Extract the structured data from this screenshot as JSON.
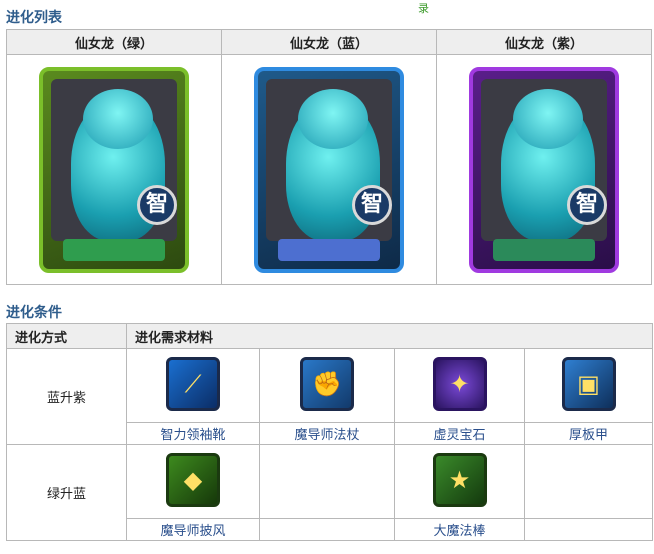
{
  "top_mark": "录",
  "evolution_list": {
    "title": "进化列表",
    "columns": [
      "仙女龙（绿）",
      "仙女龙（蓝）",
      "仙女龙（紫）"
    ],
    "cards": [
      {
        "variant": "green",
        "badge": "智",
        "frame_color": "#7bbf2a"
      },
      {
        "variant": "blue",
        "badge": "智",
        "frame_color": "#2f8be0"
      },
      {
        "variant": "purple",
        "badge": "智",
        "frame_color": "#a03ae0"
      }
    ]
  },
  "evolution_conditions": {
    "title": "进化条件",
    "headers": {
      "method": "进化方式",
      "materials": "进化需求材料"
    },
    "rows": [
      {
        "method": "蓝升紫",
        "materials": [
          {
            "name": "智力领袖靴",
            "icon": "boot-icon"
          },
          {
            "name": "魔导师法杖",
            "icon": "staff-icon"
          },
          {
            "name": "虚灵宝石",
            "icon": "gem-icon"
          },
          {
            "name": "厚板甲",
            "icon": "armor-icon"
          }
        ]
      },
      {
        "method": "绿升蓝",
        "materials": [
          {
            "name": "魔导师披风",
            "icon": "cape-icon"
          },
          {
            "name": "",
            "icon": ""
          },
          {
            "name": "大魔法棒",
            "icon": "wand-icon"
          },
          {
            "name": "",
            "icon": ""
          }
        ]
      }
    ]
  }
}
